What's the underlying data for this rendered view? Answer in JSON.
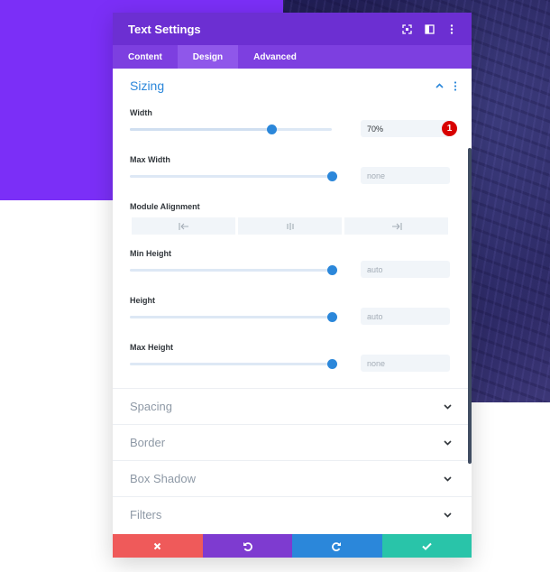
{
  "header": {
    "title": "Text Settings",
    "icons": [
      "expand-icon",
      "split-view-icon",
      "more-vertical-icon"
    ]
  },
  "tabs": [
    {
      "label": "Content",
      "active": false
    },
    {
      "label": "Design",
      "active": true
    },
    {
      "label": "Advanced",
      "active": false
    }
  ],
  "sizing": {
    "title": "Sizing",
    "width": {
      "label": "Width",
      "value": "70%",
      "slider_fraction": 0.7,
      "badge": "1"
    },
    "max_width": {
      "label": "Max Width",
      "placeholder": "none",
      "slider_fraction": 1.0
    },
    "module_alignment": {
      "label": "Module Alignment",
      "options": [
        "align-left-icon",
        "align-center-icon",
        "align-right-icon"
      ]
    },
    "min_height": {
      "label": "Min Height",
      "placeholder": "auto",
      "slider_fraction": 1.0
    },
    "height": {
      "label": "Height",
      "placeholder": "auto",
      "slider_fraction": 1.0
    },
    "max_height": {
      "label": "Max Height",
      "placeholder": "none",
      "slider_fraction": 1.0
    }
  },
  "sections": [
    {
      "label": "Spacing"
    },
    {
      "label": "Border"
    },
    {
      "label": "Box Shadow"
    },
    {
      "label": "Filters"
    }
  ],
  "footer": {
    "colors": [
      "#ef5a5a",
      "#7e3bd0",
      "#2b87da",
      "#29c4a9"
    ]
  },
  "colors": {
    "accent": "#2b87da",
    "header": "#6c2fd2",
    "tabs": "#7d3fe0",
    "badge": "#d80000"
  }
}
